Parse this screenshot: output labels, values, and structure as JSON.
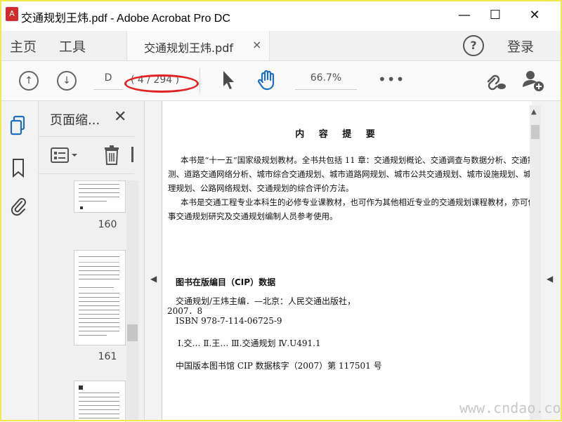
{
  "window": {
    "title": "交通规划王炜.pdf - Adobe Acrobat Pro DC",
    "controls": [
      "—",
      "☐",
      "✕"
    ]
  },
  "menu": {
    "home": "主页",
    "tools": "工具",
    "login": "登录"
  },
  "tab": {
    "label": "交通规划王炜.pdf",
    "close": "×"
  },
  "toolbar": {
    "page_input": "D",
    "page_count": "( 4 / 294 )",
    "zoom": "66.7%"
  },
  "panel": {
    "title": "页面缩...",
    "close": "✕",
    "thumbnails": [
      {
        "label": "160"
      },
      {
        "label": "161"
      }
    ]
  },
  "document": {
    "heading": "内 容 提 要",
    "para1": [
      "本书是“十一五”国家级规划教材。全书共包括 11 章：交通规划概论、交通调查与数据分析、交通需求预",
      "测、道路交通网络分析、城市综合交通规划、城市道路网规划、城市公共交通规划、城市设施规划、城市交通",
      "理规划、公路网络规划、交通规划的综合评价方法。"
    ],
    "para2": [
      "本书是交通工程专业本科生的必修专业课教材，也可作为其他相近专业的交通规划课程教材，亦可供从",
      "事交通规划研究及交通规划编制人员参考使用。"
    ],
    "cip_title": "图书在版编目（CIP）数据",
    "cip_line1": "交通规划/王炜主编．—北京：人民交通出版社，",
    "cip_line2": "2007．8",
    "cip_line3": "ISBN 978-7-114-06725-9",
    "cip_line4": "Ⅰ.交…   Ⅱ.王…   Ⅲ.交通规划   Ⅳ.U491.1",
    "cip_line5": "中国版本图书馆 CIP 数据核字（2007）第 117501 号"
  },
  "watermark": "www.cndao.com",
  "colors": {
    "annotation": "#e22222",
    "frame": "#f1e84a"
  }
}
